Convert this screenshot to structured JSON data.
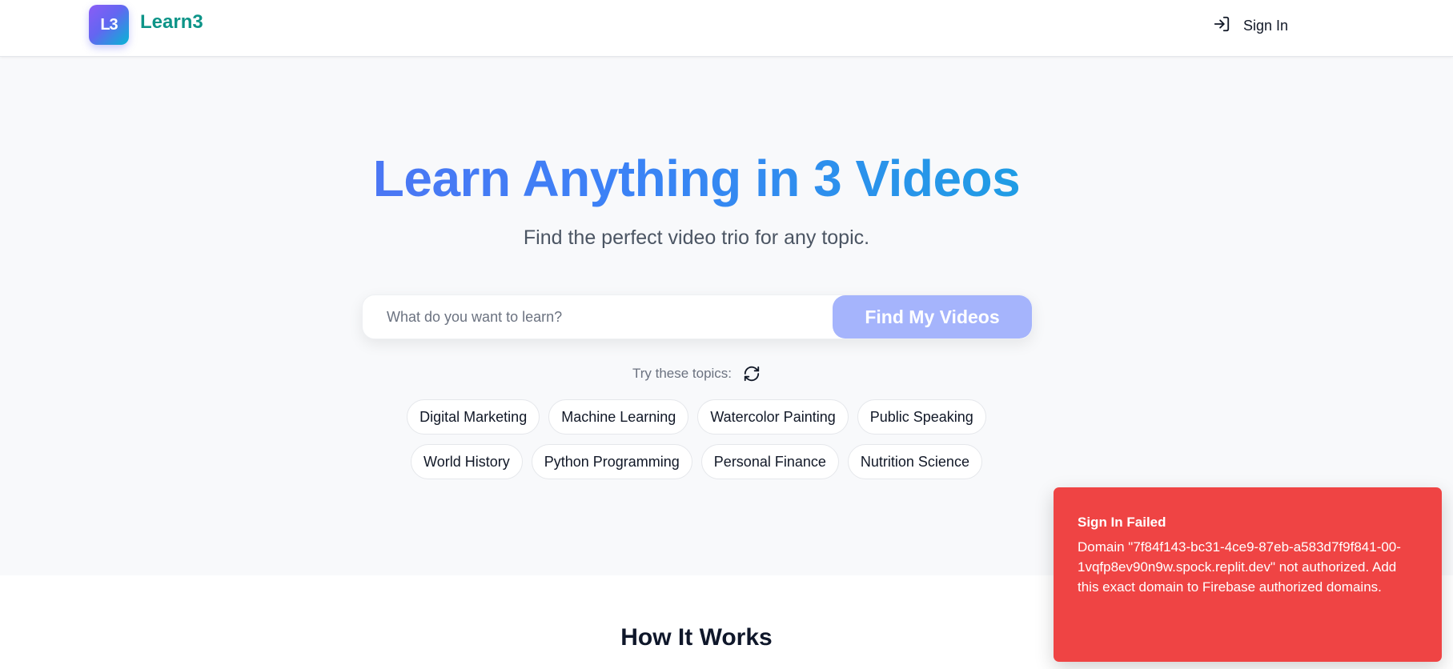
{
  "header": {
    "logo_badge": "L3",
    "logo_text": "Learn3",
    "signin_label": "Sign In"
  },
  "hero": {
    "title": "Learn Anything in 3 Videos",
    "subtitle": "Find the perfect video trio for any topic.",
    "search": {
      "placeholder": "What do you want to learn?",
      "value": "",
      "button_label": "Find My Videos"
    },
    "try_label": "Try these topics:",
    "topics_row1": [
      "Digital Marketing",
      "Machine Learning",
      "Watercolor Painting",
      "Public Speaking"
    ],
    "topics_row2": [
      "World History",
      "Python Programming",
      "Personal Finance",
      "Nutrition Science"
    ]
  },
  "how": {
    "title": "How It Works"
  },
  "toast": {
    "title": "Sign In Failed",
    "message": "Domain \"7f84f143-bc31-4ce9-87eb-a583d7f9f841-00-1vqfp8ev90n9w.spock.replit.dev\" not authorized. Add this exact domain to Firebase authorized domains."
  },
  "colors": {
    "brand_teal": "#0d9488",
    "accent_indigo": "#6366f1",
    "accent_cyan": "#06b6d4",
    "button_disabled": "#a5b4fc",
    "error_red": "#ef4444"
  },
  "icons": {
    "signin": "sign-in-icon",
    "refresh": "refresh-icon"
  }
}
